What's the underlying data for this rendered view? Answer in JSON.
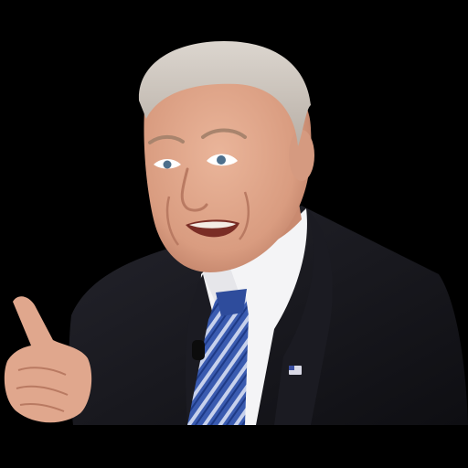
{
  "image": {
    "background_color": "#000000",
    "subject": "smiling-man-pointing",
    "colors": {
      "hair": "#cfc8c0",
      "skin": "#e2a98e",
      "skin_shadow": "#c98a70",
      "suit": "#16161c",
      "shirt": "#f4f4f6",
      "tie_blue": "#3a5bb0",
      "tie_stripe": "#c7d1ec",
      "pin": "#d9d9e6",
      "microphone": "#0c0c0c"
    }
  }
}
